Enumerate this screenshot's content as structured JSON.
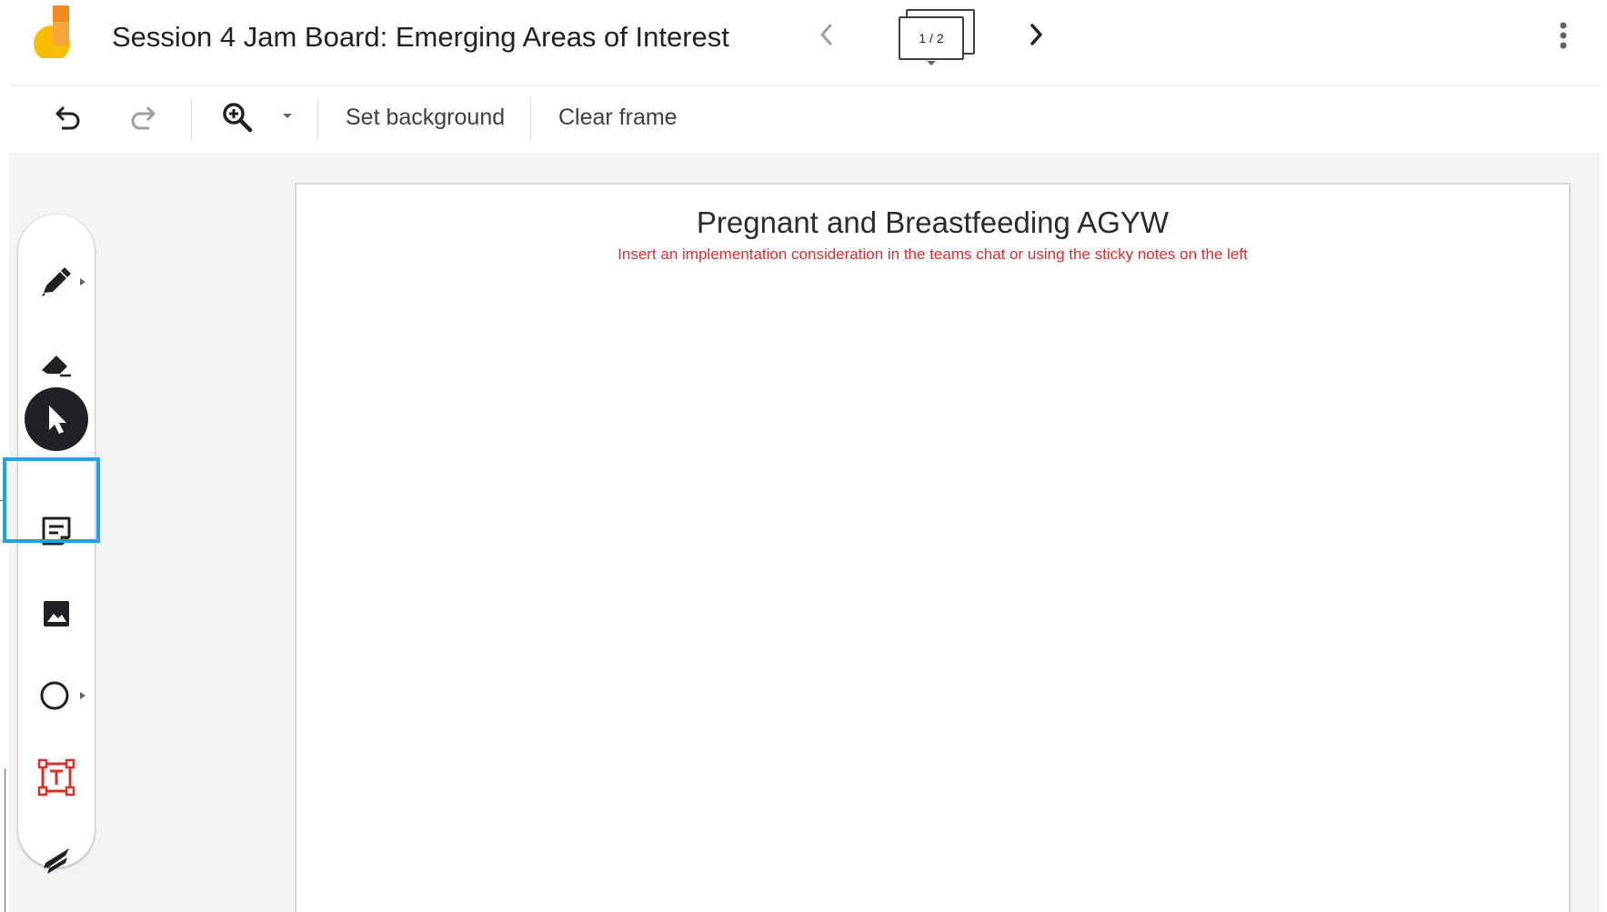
{
  "app": {
    "logo_icon": "jamboard-logo-icon"
  },
  "header": {
    "title": "Session 4 Jam Board: Emerging Areas of Interest",
    "frame_indicator": "1 / 2",
    "prev_icon": "chevron-left-icon",
    "next_icon": "chevron-right-icon",
    "more_icon": "more-vert-icon"
  },
  "toolbar": {
    "undo_icon": "undo-icon",
    "redo_icon": "redo-icon",
    "zoom_icon": "zoom-in-icon",
    "set_background_label": "Set background",
    "clear_frame_label": "Clear frame"
  },
  "tools": [
    {
      "name": "pen",
      "icon": "pen-icon"
    },
    {
      "name": "eraser",
      "icon": "eraser-icon"
    },
    {
      "name": "select",
      "icon": "cursor-icon",
      "active": true
    },
    {
      "name": "sticky-note",
      "icon": "sticky-note-icon",
      "highlighted": true
    },
    {
      "name": "image",
      "icon": "image-icon"
    },
    {
      "name": "shape",
      "icon": "circle-icon"
    },
    {
      "name": "text-box",
      "icon": "text-box-icon"
    },
    {
      "name": "laser",
      "icon": "laser-icon"
    }
  ],
  "frame": {
    "title": "Pregnant and Breastfeeding AGYW",
    "subtitle": "Insert an implementation consideration in the teams chat or using the sticky notes on the left"
  },
  "colors": {
    "subtitle_red": "#e02b2b",
    "highlight_blue": "#1aa5e6",
    "canvas_bg": "#f1f3f4",
    "logo_yellow": "#fbbc04",
    "logo_orange": "#f28b1e"
  }
}
